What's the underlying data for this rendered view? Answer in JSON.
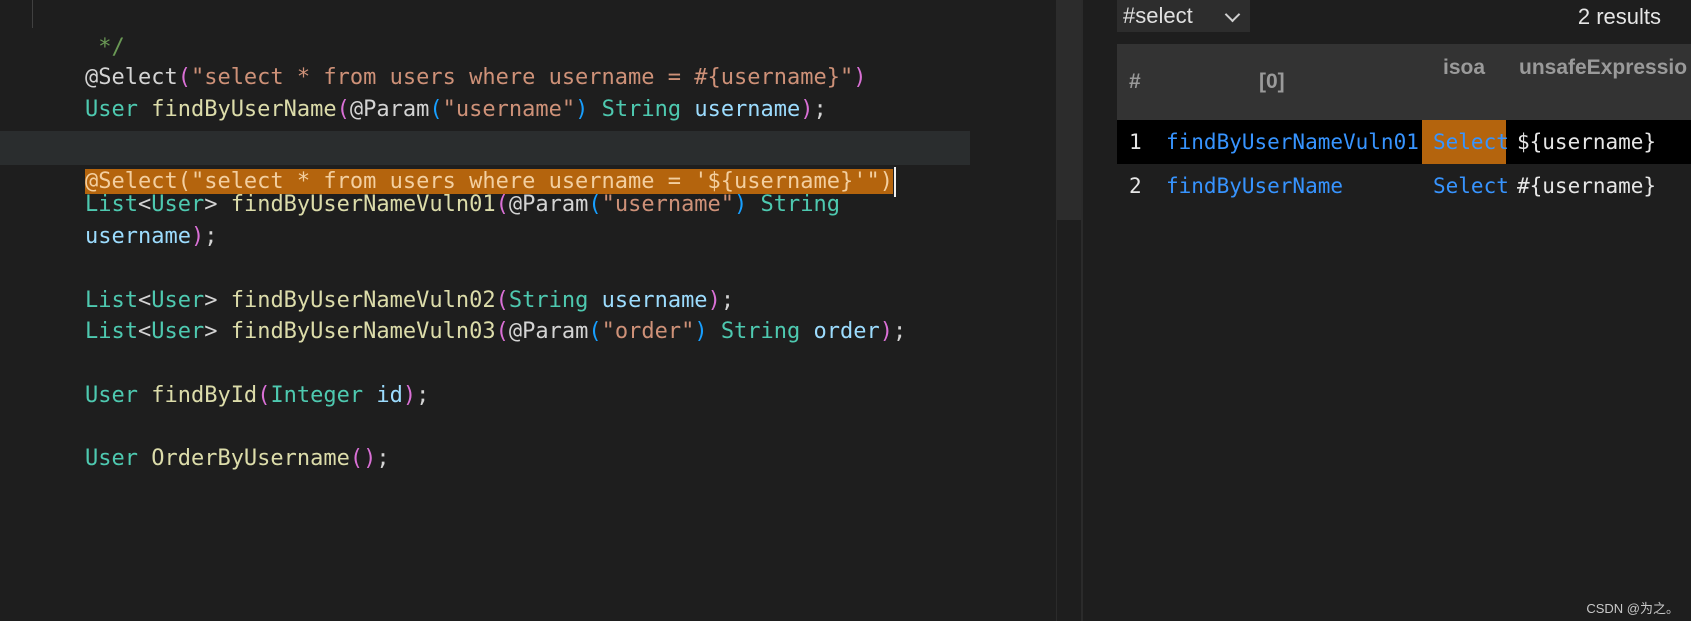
{
  "editor": {
    "comment_end": " */",
    "lines": {
      "l1": {
        "ann": "@Select",
        "p1": "(",
        "str": "\"select * from users where username = #{username}\"",
        "p2": ")"
      },
      "l2": {
        "type": "User",
        "sp": " ",
        "fn": "findByUserName",
        "p1": "(",
        "ann": "@Param",
        "p2": "(",
        "str": "\"username\"",
        "p3": ")",
        "sp2": " ",
        "type2": "String",
        "sp3": " ",
        "var": "username",
        "p4": ")",
        "semi": ";"
      },
      "l3": {
        "ann": "@Select",
        "p1": "(",
        "str": "\"select * from users where username = '${username}'\"",
        "p2": ")"
      },
      "l4": {
        "type": "List",
        "lt": "<",
        "type2": "User",
        "gt": ">",
        "sp": " ",
        "fn": "findByUserNameVuln01",
        "p1": "(",
        "ann": "@Param",
        "p2": "(",
        "str": "\"username\"",
        "p3": ")",
        "sp2": " ",
        "type3": "String"
      },
      "l5": {
        "var": "username",
        "p1": ")",
        "semi": ";"
      },
      "l6": {
        "type": "List",
        "lt": "<",
        "type2": "User",
        "gt": ">",
        "sp": " ",
        "fn": "findByUserNameVuln02",
        "p1": "(",
        "type3": "String",
        "sp2": " ",
        "var": "username",
        "p2": ")",
        "semi": ";"
      },
      "l7": {
        "type": "List",
        "lt": "<",
        "type2": "User",
        "gt": ">",
        "sp": " ",
        "fn": "findByUserNameVuln03",
        "p1": "(",
        "ann": "@Param",
        "p2": "(",
        "str": "\"order\"",
        "p3": ")",
        "sp2": " ",
        "type3": "String",
        "sp3": " ",
        "var": "order",
        "p4": ")",
        "semi": ";"
      },
      "l8": {
        "type": "User",
        "sp": " ",
        "fn": "findById",
        "p1": "(",
        "type2": "Integer",
        "sp2": " ",
        "var": "id",
        "p2": ")",
        "semi": ";"
      },
      "l9": {
        "type": "User",
        "sp": " ",
        "fn": "OrderByUsername",
        "p1": "()",
        "semi": ";"
      }
    }
  },
  "results": {
    "query": "#select",
    "count": "2 results",
    "headers": {
      "num": "#",
      "col0": "[0]",
      "col1": "isoa",
      "col2": "unsafeExpressio"
    },
    "rows": [
      {
        "num": "1",
        "col0": "findByUserNameVuln01",
        "col1": "Select",
        "col2": "${username}"
      },
      {
        "num": "2",
        "col0": "findByUserName",
        "col1": "Select",
        "col2": "#{username}"
      }
    ]
  },
  "watermark": "CSDN @为之。",
  "colors": {
    "selection": "#b4640d",
    "link": "#3794ff",
    "type": "#4ec9b0",
    "function": "#dcdcaa",
    "string": "#ce9178",
    "variable": "#9cdcfe"
  }
}
